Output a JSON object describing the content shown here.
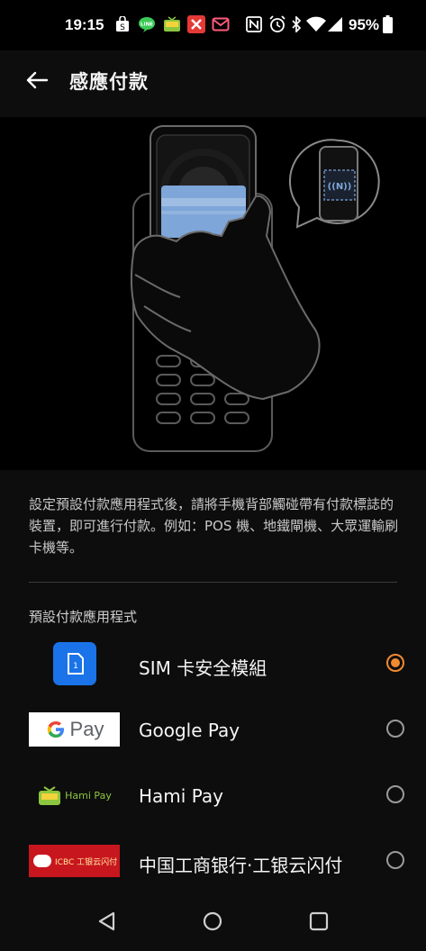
{
  "status_bar": {
    "time": "19:15",
    "battery_percent": "95%",
    "icons": [
      "shopping-bag-icon",
      "line-app-icon",
      "tv-app-icon",
      "missed-call-icon",
      "mail-icon",
      "nfc-icon",
      "alarm-icon",
      "bluetooth-icon",
      "wifi-icon",
      "signal-icon",
      "battery-icon"
    ]
  },
  "app_bar": {
    "title": "感應付款"
  },
  "description": "設定預設付款應用程式後，請將手機背部觸碰帶有付款標誌的裝置，即可進行付款。例如：POS 機、地鐵閘機、大眾運輸刷卡機等。",
  "section_title": "預設付款應用程式",
  "payment_apps": [
    {
      "label": "SIM 卡安全模組",
      "selected": true
    },
    {
      "label": "Google Pay",
      "selected": false,
      "logo_text": "Pay"
    },
    {
      "label": "Hami Pay",
      "selected": false,
      "logo_text": "Hami Pay"
    },
    {
      "label": "中国工商银行·工银云闪付",
      "selected": false,
      "logo_text": "ICBC 工银云闪付"
    }
  ],
  "colors": {
    "accent": "#f28a2e",
    "sim_icon_bg": "#1a73e8",
    "card_blue": "#7ea6d8"
  }
}
